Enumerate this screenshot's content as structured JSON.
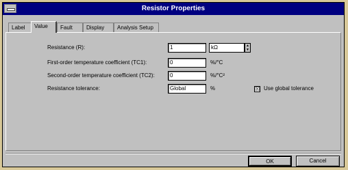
{
  "window": {
    "title": "Resistor Properties"
  },
  "tabs": [
    {
      "label": "Label",
      "active": false
    },
    {
      "label": "Value",
      "active": true
    },
    {
      "label": "Fault",
      "active": false
    },
    {
      "label": "Display",
      "active": false
    },
    {
      "label": "Analysis Setup",
      "active": false
    }
  ],
  "fields": {
    "resistance": {
      "label": "Resistance (R):",
      "value": "1",
      "unit": "kΩ"
    },
    "tc1": {
      "label": "First-order temperature coefficient (TC1):",
      "value": "0",
      "unit": "%/°C"
    },
    "tc2": {
      "label": "Second-order temperature coefficient (TC2):",
      "value": "0",
      "unit": "%/°C²"
    },
    "tolerance": {
      "label": "Resistance tolerance:",
      "value": "Global",
      "unit": "%"
    }
  },
  "global_tolerance": {
    "label": "Use global tolerance",
    "checked": true,
    "mark": "☒"
  },
  "buttons": {
    "ok": "OK",
    "cancel": "Cancel"
  }
}
